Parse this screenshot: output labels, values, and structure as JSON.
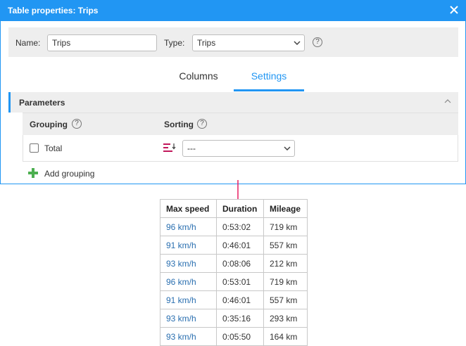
{
  "dialog": {
    "title": "Table properties: Trips",
    "name_label": "Name:",
    "name_value": "Trips",
    "type_label": "Type:",
    "type_value": "Trips",
    "help_glyph": "?"
  },
  "tabs": [
    {
      "label": "Columns",
      "active": false
    },
    {
      "label": "Settings",
      "active": true
    }
  ],
  "parameters": {
    "title": "Parameters",
    "grouping_header": "Grouping",
    "sorting_header": "Sorting",
    "row_label": "Total",
    "row_checked": false,
    "sorting_value": "---",
    "add_grouping": "Add grouping"
  },
  "colors": {
    "accent": "#2196f3",
    "link": "#2a6fb0",
    "plus": "#4caf50",
    "sort_icon": "#c2185b",
    "arrow": "#e91e63"
  },
  "table": {
    "headers": [
      "Max speed",
      "Duration",
      "Mileage"
    ],
    "rows": [
      [
        "96 km/h",
        "0:53:02",
        "719 km"
      ],
      [
        "91 km/h",
        "0:46:01",
        "557 km"
      ],
      [
        "93 km/h",
        "0:08:06",
        "212 km"
      ],
      [
        "96 km/h",
        "0:53:01",
        "719 km"
      ],
      [
        "91 km/h",
        "0:46:01",
        "557 km"
      ],
      [
        "93 km/h",
        "0:35:16",
        "293 km"
      ],
      [
        "93 km/h",
        "0:05:50",
        "164 km"
      ]
    ]
  }
}
